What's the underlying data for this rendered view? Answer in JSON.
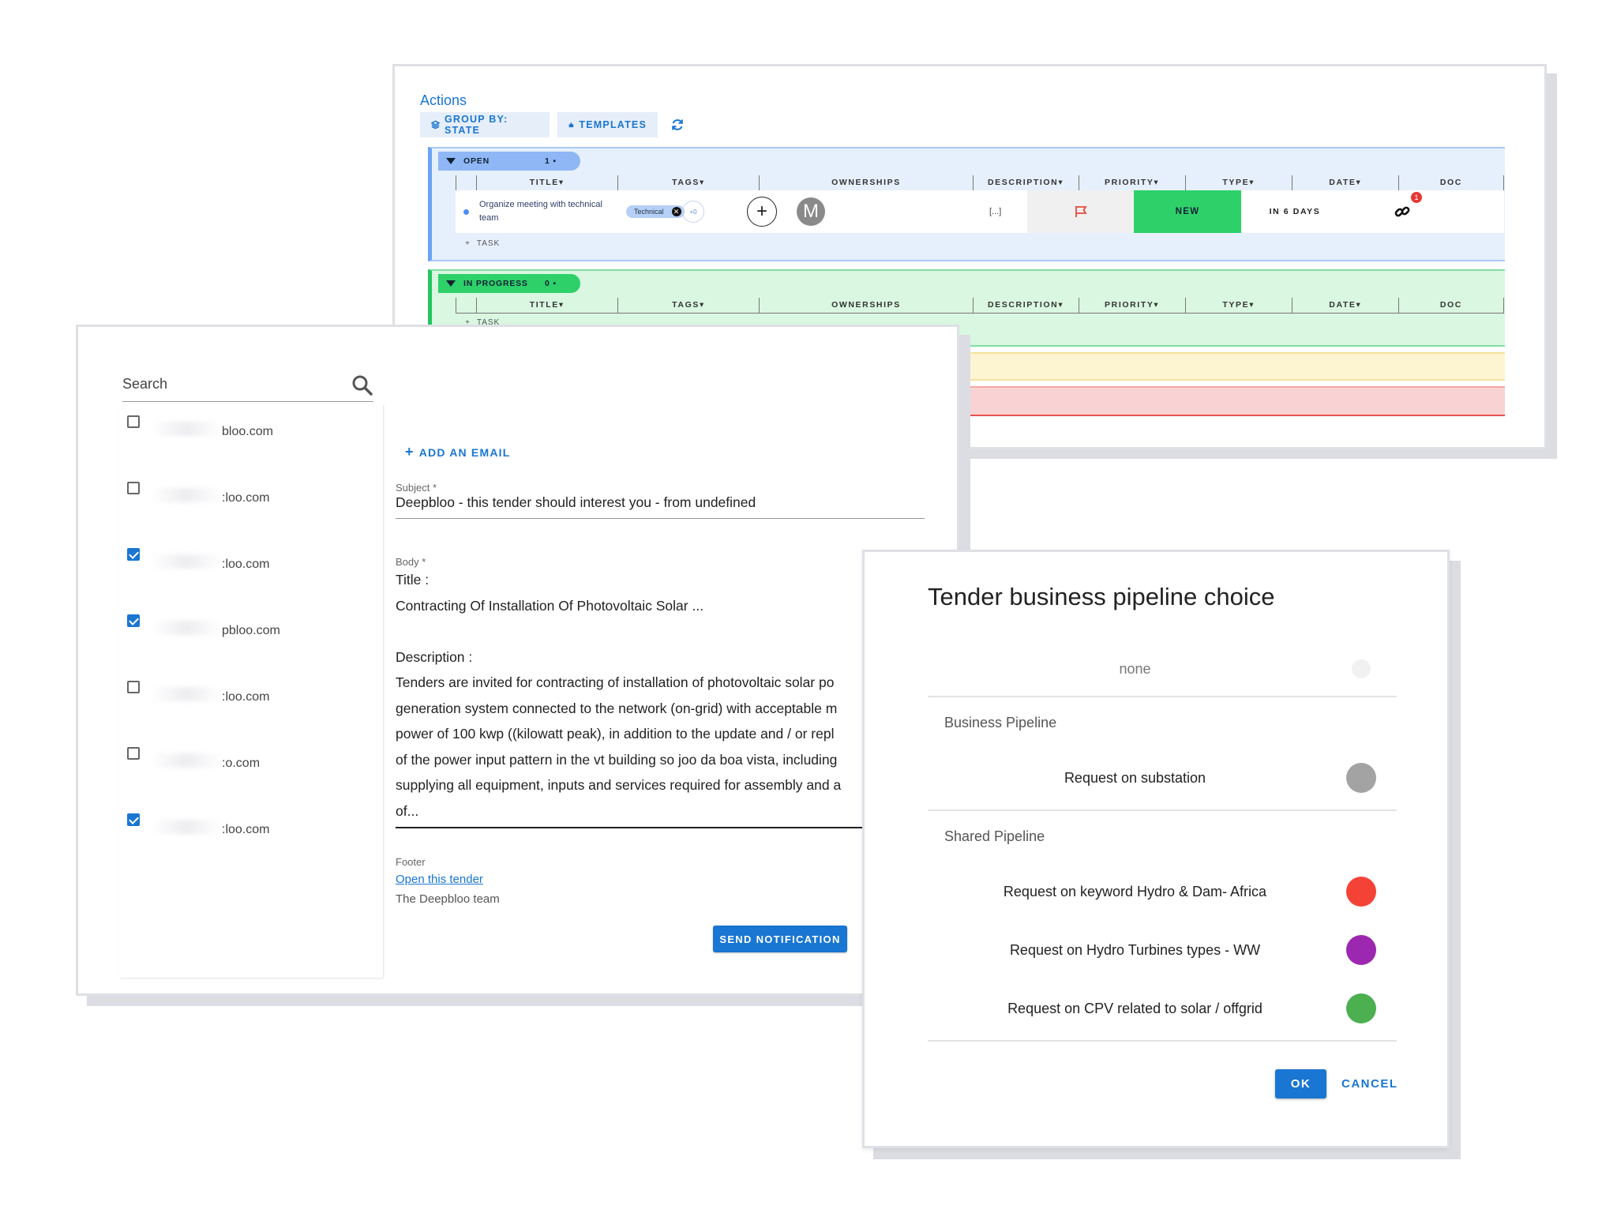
{
  "actions": {
    "title": "Actions",
    "group_by_label": "GROUP BY: STATE",
    "templates_label": "TEMPLATES",
    "columns": [
      "",
      "TITLE▾",
      "TAGS▾",
      "OWNERSHIPS",
      "DESCRIPTION▾",
      "PRIORITY▾",
      "TYPE▾",
      "DATE▾",
      "DOC"
    ],
    "groups": {
      "open": {
        "label": "OPEN",
        "count": "1"
      },
      "in_progress": {
        "label": "IN PROGRESS",
        "count": "0"
      }
    },
    "task": {
      "title": "Organize meeting with technical team",
      "tag": "Technical",
      "tag_count": "+0",
      "avatar_initial": "M",
      "description": "[...]",
      "type": "NEW",
      "date": "IN 6 DAYS",
      "doc_badge": "1"
    },
    "add_task_label": "TASK",
    "colors": {
      "accent": "#1976d2",
      "open": "#8fb7f5",
      "in_progress": "#2ed06a",
      "yellow": "#fdf5d2",
      "red": "#f9d3d3",
      "priority_flag": "#e64a3b"
    }
  },
  "email": {
    "search_placeholder": "Search",
    "recipients": [
      {
        "label": "bloo.com",
        "checked": false
      },
      {
        "label": ":loo.com",
        "checked": false
      },
      {
        "label": ":loo.com",
        "checked": true
      },
      {
        "label": "pbloo.com",
        "checked": true
      },
      {
        "label": ":loo.com",
        "checked": false
      },
      {
        "label": ":o.com",
        "checked": false
      },
      {
        "label": ":loo.com",
        "checked": true
      }
    ],
    "add_email_label": "ADD AN EMAIL",
    "subject_label": "Subject *",
    "subject_value": "Deepbloo - this tender should interest you - from undefined",
    "body_label": "Body *",
    "body_lines": [
      "Title :",
      "Contracting Of Installation Of Photovoltaic Solar ...",
      "",
      "Description :",
      "Tenders are invited for contracting of installation of photovoltaic solar po",
      "generation system connected to the network (on-grid) with acceptable m",
      "power of 100 kwp ((kilowatt peak), in addition to the update and / or repl",
      "of the power input pattern in the vt building so joo da boa vista, including",
      "supplying all equipment, inputs and services required for assembly and a",
      "of..."
    ],
    "footer_label": "Footer",
    "footer_link": "Open this tender",
    "footer_sign": "The Deepbloo team",
    "send_label": "SEND NOTIFICATION"
  },
  "pipeline_dialog": {
    "title": "Tender business pipeline choice",
    "none_label": "none",
    "business_section": "Business Pipeline",
    "shared_section": "Shared Pipeline",
    "options": [
      {
        "label": "Request on substation",
        "color": "#a3a3a3"
      },
      {
        "label": "Request on keyword Hydro & Dam- Africa",
        "color": "#f44336"
      },
      {
        "label": "Request on Hydro Turbines types - WW",
        "color": "#9c27b0"
      },
      {
        "label": "Request on CPV related to solar / offgrid",
        "color": "#4caf50"
      }
    ],
    "ok_label": "OK",
    "cancel_label": "CANCEL"
  }
}
